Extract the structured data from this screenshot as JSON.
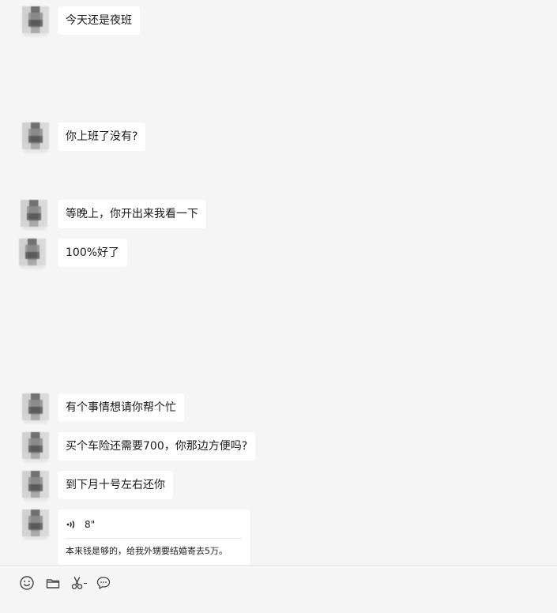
{
  "messages": [
    {
      "text": "今天还是夜班"
    },
    {
      "text": "你上班了没有?"
    },
    {
      "text": "等晚上，你开出来我看一下"
    },
    {
      "text": "100%好了"
    },
    {
      "text": "有个事情想请你帮个忙"
    },
    {
      "text": "买个车险还需要700，你那边方便吗?"
    },
    {
      "text": "到下月十号左右还你"
    }
  ],
  "voice": {
    "duration": "8\"",
    "transcript": "本来钱是够的，给我外甥要结婚寄去5万。"
  },
  "toolbar": {
    "icons": [
      "emoji-icon",
      "folder-icon",
      "scissors-icon",
      "chat-bubble-icon"
    ]
  }
}
